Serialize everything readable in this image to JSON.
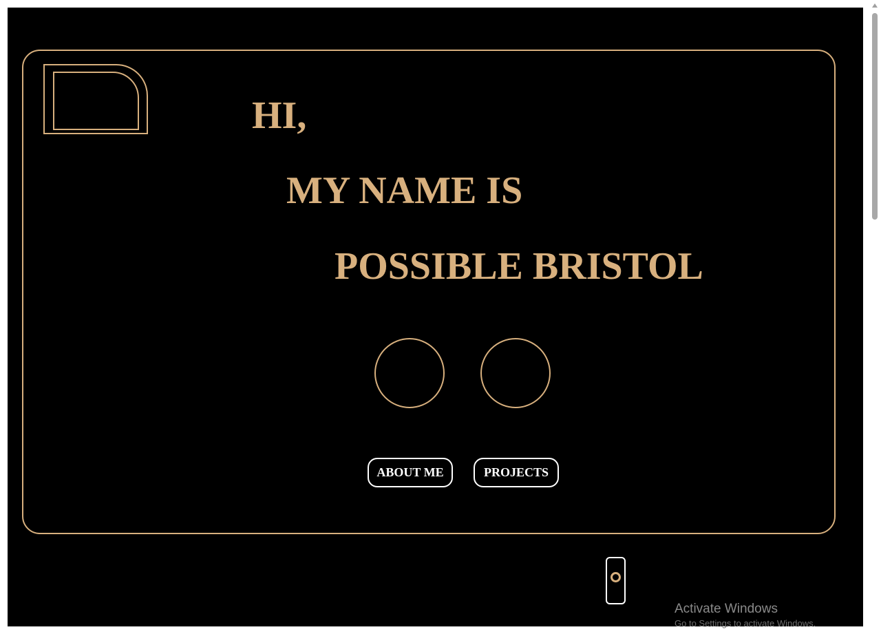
{
  "hero": {
    "line1": "HI,",
    "line2": "MY NAME IS",
    "line3": "POSSIBLE BRISTOL"
  },
  "buttons": {
    "about": "ABOUT ME",
    "projects": "PROJECTS"
  },
  "os_watermark": {
    "title": "Activate Windows",
    "subtitle": "Go to Settings to activate Windows."
  },
  "colors": {
    "background": "#000000",
    "accent": "#d8b07e",
    "button_border": "#ffffff"
  },
  "icons": {
    "toggle": "toggle-switch-icon",
    "scroll_up": "chevron-up-icon"
  }
}
